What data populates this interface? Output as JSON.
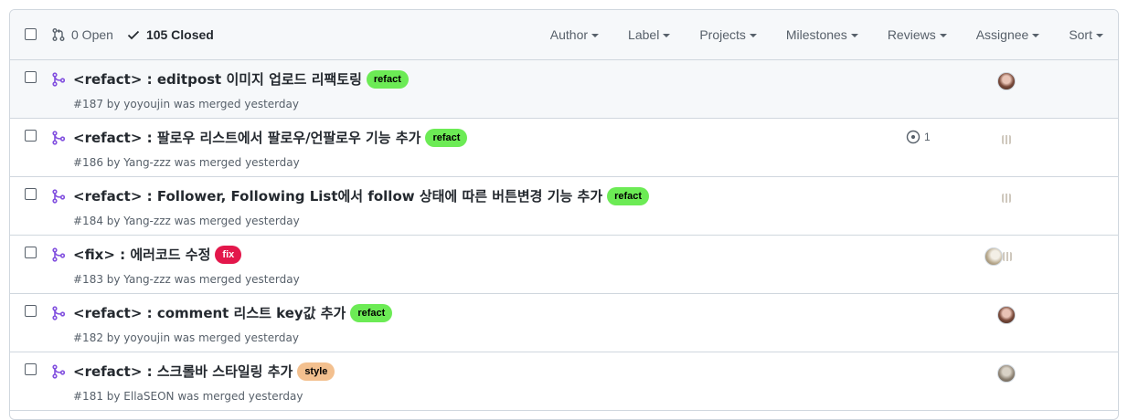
{
  "header": {
    "open_label": "0 Open",
    "closed_label": "105 Closed",
    "filters": [
      "Author",
      "Label",
      "Projects",
      "Milestones",
      "Reviews",
      "Assignee",
      "Sort"
    ]
  },
  "colors": {
    "merged_purple": "#8250df",
    "refact": "#6ceb55",
    "fix": "#e3174b",
    "style": "#f3c08f"
  },
  "rows": [
    {
      "title": "<refact> : editpost 이미지 업로드 리팩토링",
      "label": "refact",
      "meta": "#187 by yoyoujin was merged yesterday",
      "comments": "",
      "avatar": "photo-1"
    },
    {
      "title": "<refact> : 팔로우 리스트에서 팔로우/언팔로우 기능 추가",
      "label": "refact",
      "meta": "#186 by Yang-zzz was merged yesterday",
      "comments": "1",
      "avatar": "tiny"
    },
    {
      "title": "<refact> : Follower, Following List에서 follow 상태에 따른 버튼변경 기능 추가",
      "label": "refact",
      "meta": "#184 by Yang-zzz was merged yesterday",
      "comments": "",
      "avatar": "tiny"
    },
    {
      "title": "<fix> : 에러코드 수정",
      "label": "fix",
      "meta": "#183 by Yang-zzz was merged yesterday",
      "comments": "",
      "avatar": "double"
    },
    {
      "title": "<refact> : comment 리스트 key값 추가",
      "label": "refact",
      "meta": "#182 by yoyoujin was merged yesterday",
      "comments": "",
      "avatar": "photo-1"
    },
    {
      "title": "<refact> : 스크롤바 스타일링 추가",
      "label": "style",
      "meta": "#181 by EllaSEON was merged yesterday",
      "comments": "",
      "avatar": "photo-2"
    }
  ]
}
